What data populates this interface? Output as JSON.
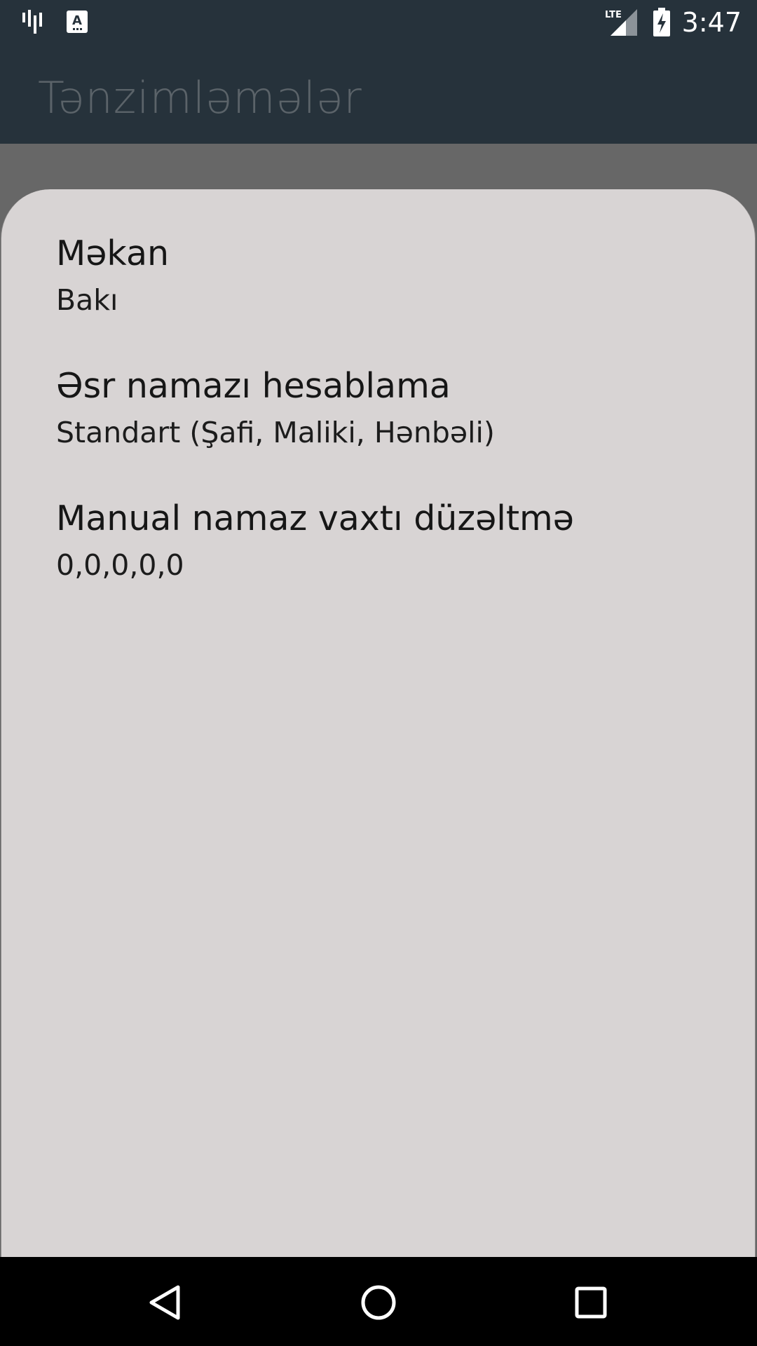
{
  "status_bar": {
    "time": "3:47",
    "network_label": "LTE",
    "icons": [
      "signal-bars-app-icon",
      "font-a-icon",
      "lte-signal-icon",
      "battery-charging-icon"
    ]
  },
  "app_bar": {
    "title": "Tənzimləmələr"
  },
  "preferences": [
    {
      "title": "Məkan",
      "summary": "Bakı"
    },
    {
      "title": "Əsr namazı hesablama",
      "summary": "Standart (Şafi, Maliki, Hənbəli)"
    },
    {
      "title": "Manual namaz vaxtı düzəltmə",
      "summary": "0,0,0,0,0"
    }
  ],
  "nav_bar": {
    "icons": [
      "back-icon",
      "home-icon",
      "recents-icon"
    ]
  },
  "colors": {
    "status_bar": "#26323b",
    "app_bar": "#26323b",
    "scrim": "#676767",
    "sheet": "#d8d4d4",
    "nav_bar": "#000000"
  }
}
